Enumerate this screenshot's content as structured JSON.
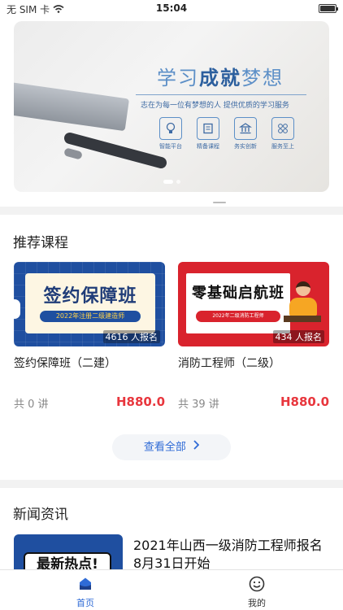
{
  "status_bar": {
    "carrier": "无 SIM 卡",
    "time": "15:04"
  },
  "banner": {
    "slogan_light": "学习",
    "slogan_bold": "成就",
    "slogan_tail": "梦想",
    "subtitle": "志在为每一位有梦想的人   提供优质的学习服务",
    "features": [
      {
        "label": "智能平台",
        "icon": "bulb-icon"
      },
      {
        "label": "精备课程",
        "icon": "book-icon"
      },
      {
        "label": "务实创新",
        "icon": "building-icon"
      },
      {
        "label": "服务至上",
        "icon": "grid-icon"
      }
    ]
  },
  "courses": {
    "title": "推荐课程",
    "items": [
      {
        "banner_text": "签约保障班",
        "banner_tag": "2022年注册二级建造师",
        "enrolled": "4616 人报名",
        "name": "签约保障班（二建）",
        "lessons": "共 0 讲",
        "price": "H880.0"
      },
      {
        "banner_text": "零基础启航班",
        "banner_tag": "2022年二级消防工程师",
        "enrolled": "434 人报名",
        "name": "消防工程师（二级）",
        "lessons": "共 39 讲",
        "price": "H880.0"
      }
    ],
    "view_all": "查看全部"
  },
  "news": {
    "title": "新闻资讯",
    "items": [
      {
        "thumb_text": "最新热点!",
        "headline": "2021年山西一级消防工程师报名8月31日开始"
      }
    ]
  },
  "tabs": [
    {
      "label": "首页",
      "icon": "home-icon",
      "active": true
    },
    {
      "label": "我的",
      "icon": "smiley-icon",
      "active": false
    }
  ],
  "colors": {
    "accent": "#2f6bd6",
    "price": "#e8363d"
  }
}
